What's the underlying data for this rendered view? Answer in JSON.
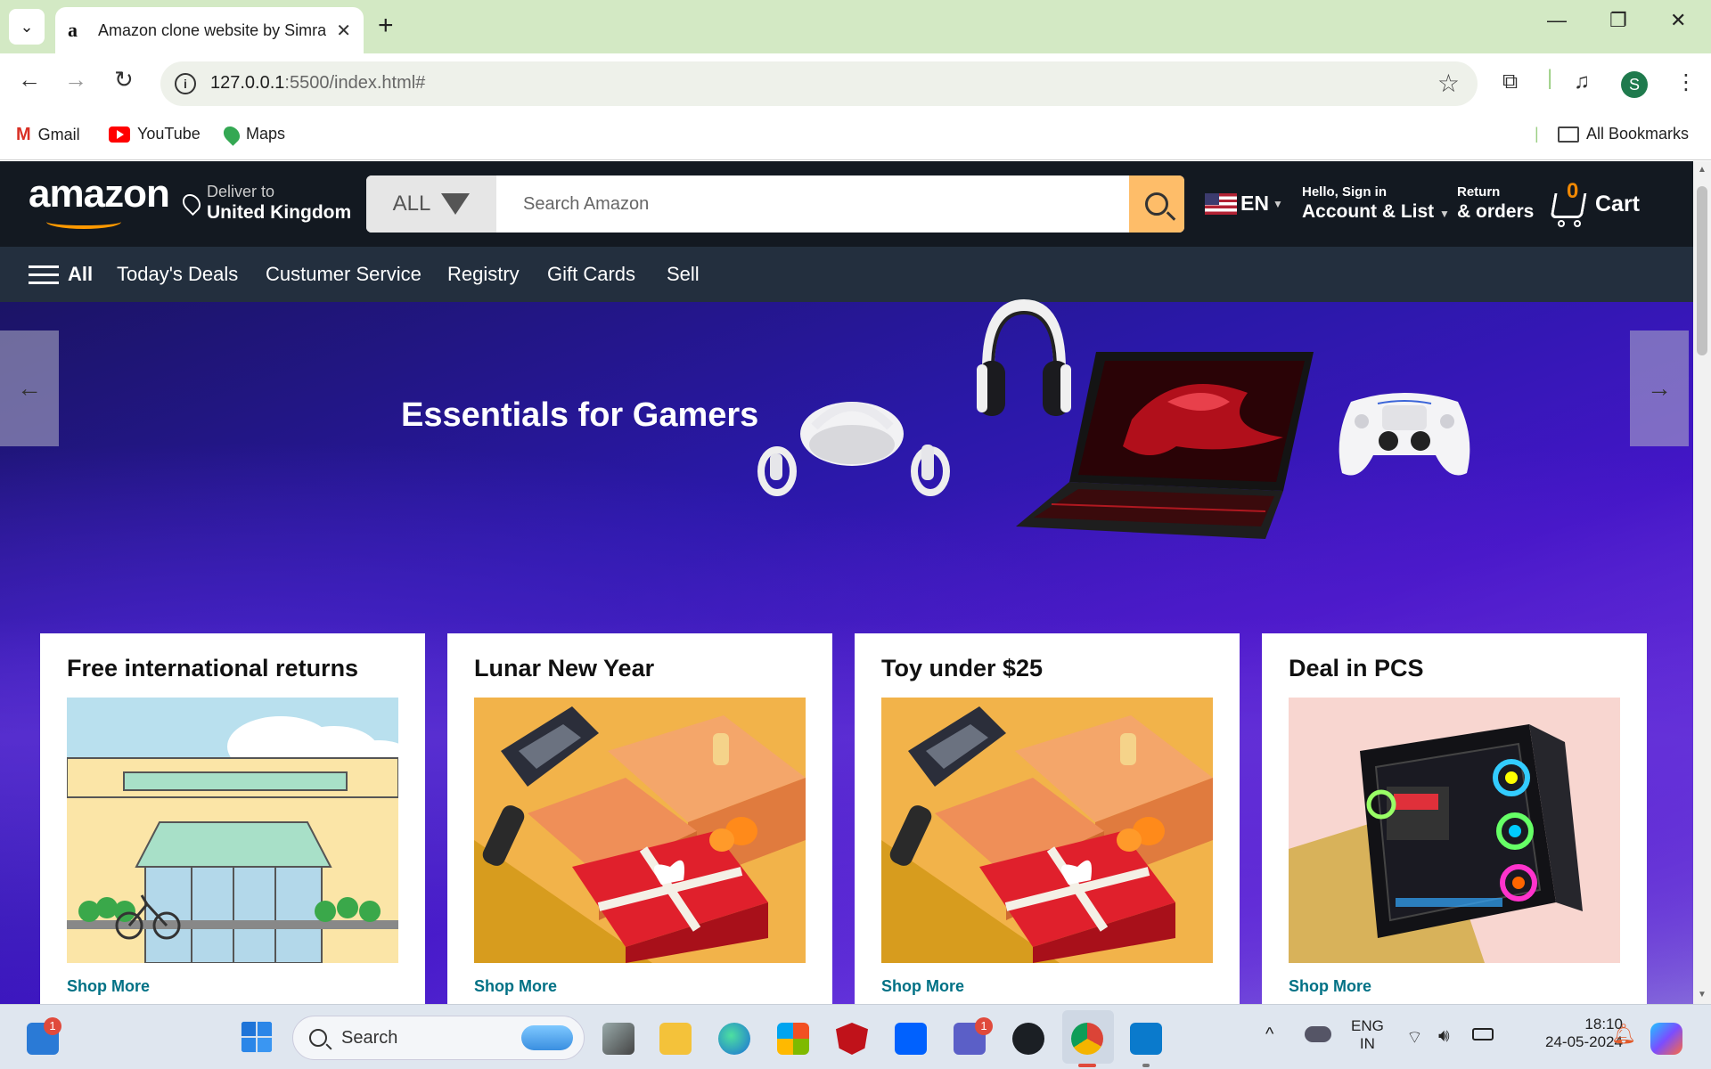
{
  "browser": {
    "tab_title": "Amazon clone website by Simra",
    "url_host": "127.0.0.1",
    "url_rest": ":5500/index.html#",
    "profile_initial": "S",
    "bookmarks": [
      {
        "label": "Gmail"
      },
      {
        "label": "YouTube"
      },
      {
        "label": "Maps"
      }
    ],
    "all_bookmarks_label": "All Bookmarks"
  },
  "site": {
    "logo_text": "amazon",
    "deliver_line1": "Deliver to",
    "deliver_line2": "United Kingdom",
    "search_category": "ALL",
    "search_placeholder": "Search Amazon",
    "language": "EN",
    "account_line1": "Hello, Sign in",
    "account_line2": "Account & List",
    "returns_line1": "Return",
    "returns_line2": "& orders",
    "cart_count": "0",
    "cart_label": "Cart",
    "subnav": [
      "All",
      "Today's Deals",
      "Custumer Service",
      "Registry",
      "Gift Cards",
      "Sell"
    ]
  },
  "hero": {
    "title": "Essentials for Gamers"
  },
  "cards": [
    {
      "title": "Free international returns",
      "link": "Shop More",
      "image": "storefront"
    },
    {
      "title": "Lunar New Year",
      "link": "Shop More",
      "image": "gift-box"
    },
    {
      "title": "Toy under $25",
      "link": "Shop More",
      "image": "gift-box"
    },
    {
      "title": "Deal in PCS",
      "link": "Shop More",
      "image": "gaming-pc"
    }
  ],
  "taskbar": {
    "search_label": "Search",
    "widgets_badge": "1",
    "teams_badge": "1",
    "lang_line1": "ENG",
    "lang_line2": "IN",
    "time": "18:10",
    "date": "24-05-2024"
  },
  "colors": {
    "amazon_nav": "#131921",
    "amazon_subnav": "#232f3e",
    "search_button": "#febd69",
    "link": "#007185",
    "chrome_frame": "#d3e9c4"
  }
}
